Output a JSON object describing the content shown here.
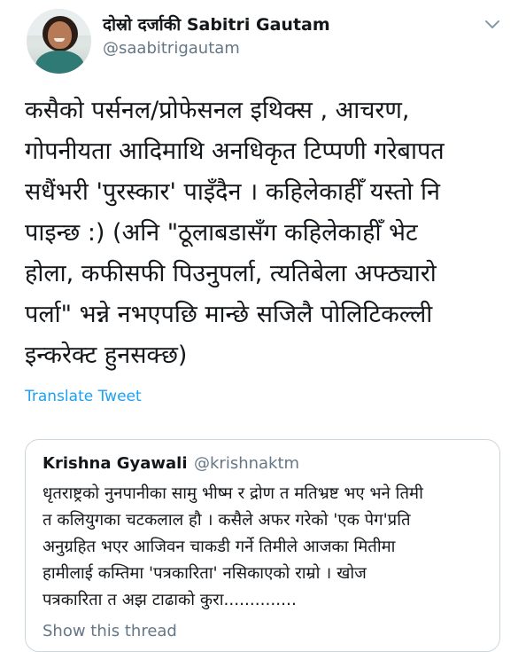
{
  "author": {
    "display_name": "दोस्रो दर्जाकी Sabitri Gautam",
    "handle": "@saabitrigautam"
  },
  "menu_icon": "chevron-down-icon",
  "tweet": {
    "text": "कसैको पर्सनल/प्रोफेसनल इथिक्स , आचरण,\nगोपनीयता आदिमाथि अनधिकृत टिप्पणी गरेबापत\nसधैंभरी 'पुरस्कार' पाइँदैन । कहिलेकाहीँ यस्तो नि\nपाइन्छ :) (अनि \"ठूलाबडासँग कहिलेकाहीँ भेट\nहोला, कफीसफी पिउनुपर्ला, त्यतिबेला अफ्ठ्यारो\nपर्ला\" भन्ने नभएपछि मान्छे सजिलै पोलिटिकल्ली\nइन्करेक्ट हुनसक्छ)",
    "translate_label": "Translate Tweet"
  },
  "quoted_tweet": {
    "display_name": "Krishna Gyawali",
    "handle": "@krishnaktm",
    "text": "धृतराष्ट्रको नुनपानीका सामु भीष्म र द्रोण त मतिभ्रष्ट भए भने तिमी\nत कलियुगका चटकलाल हौ । कसैले अफर गरेको 'एक पेग'प्रति\nअनुग्रहित भएर आजिवन चाकडी गर्ने तिमीले आजका मितीमा\nहामीलाई कम्तिमा 'पत्रकारिता' नसिकाएको राम्रो । खोज\nपत्रकारिता त अझ टाढाको कुरा..............",
    "show_thread_label": "Show this thread"
  },
  "colors": {
    "link": "#1da1f2",
    "secondary": "#657786",
    "text": "#14171a",
    "border": "#ccd6dd"
  }
}
